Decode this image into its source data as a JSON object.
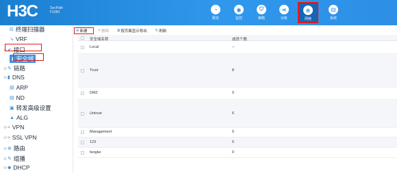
{
  "brand": {
    "logo": "H3C",
    "model_line1": "SecPath",
    "model_line2": "F1060"
  },
  "nav": [
    {
      "label": "概览",
      "icon": "dashboard-icon",
      "glyph": "◔"
    },
    {
      "label": "监控",
      "icon": "monitor-icon",
      "glyph": "◉"
    },
    {
      "label": "策略",
      "icon": "shield-icon",
      "glyph": "⛉"
    },
    {
      "label": "对象",
      "icon": "share-icon",
      "glyph": "⋖"
    },
    {
      "label": "网络",
      "icon": "globe-icon",
      "glyph": "⊕",
      "active": true
    },
    {
      "label": "系统",
      "icon": "system-icon",
      "glyph": "⊟"
    }
  ],
  "sidebar": [
    {
      "label": "终端扫描器",
      "icon": "scanner-icon",
      "glyph": "⊟"
    },
    {
      "label": "VRF",
      "icon": "vrf-icon",
      "glyph": "↘"
    },
    {
      "label": "接口",
      "icon": "interface-icon",
      "glyph": "✔"
    },
    {
      "label": "安全域",
      "icon": "security-zone-icon",
      "glyph": "▮"
    },
    {
      "label": "链路",
      "icon": "link-icon",
      "glyph": "✎"
    },
    {
      "label": "DNS",
      "icon": "dns-icon",
      "glyph": "▮"
    },
    {
      "label": "ARP",
      "icon": "arp-icon",
      "glyph": "▤"
    },
    {
      "label": "ND",
      "icon": "nd-icon",
      "glyph": "▤"
    },
    {
      "label": "转发高级设置",
      "icon": "forwarding-icon",
      "glyph": "▣"
    },
    {
      "label": "ALG",
      "icon": "alg-icon",
      "glyph": "▲"
    },
    {
      "label": "VPN",
      "icon": "vpn-icon",
      "glyph": "≈"
    },
    {
      "label": "SSL VPN",
      "icon": "ssl-vpn-icon",
      "glyph": "≈"
    },
    {
      "label": "路由",
      "icon": "route-icon",
      "glyph": "⊛"
    },
    {
      "label": "组播",
      "icon": "multicast-icon",
      "glyph": "✎"
    },
    {
      "label": "DHCP",
      "icon": "dhcp-icon",
      "glyph": "◆"
    }
  ],
  "toolbar": {
    "new": "新建",
    "delete": "删除",
    "export": "按页面显示导出",
    "refresh": "刷新"
  },
  "table": {
    "headers": [
      "安全域名称",
      "成员个数"
    ],
    "rows": [
      {
        "name": "Local",
        "count": "--"
      },
      {
        "name": "Trust",
        "count": "8"
      },
      {
        "name": "DMZ",
        "count": "0"
      },
      {
        "name": "Untrust",
        "count": "6"
      },
      {
        "name": "Management",
        "count": "0"
      },
      {
        "name": "123",
        "count": "0"
      },
      {
        "name": "fangke",
        "count": "0"
      }
    ]
  }
}
